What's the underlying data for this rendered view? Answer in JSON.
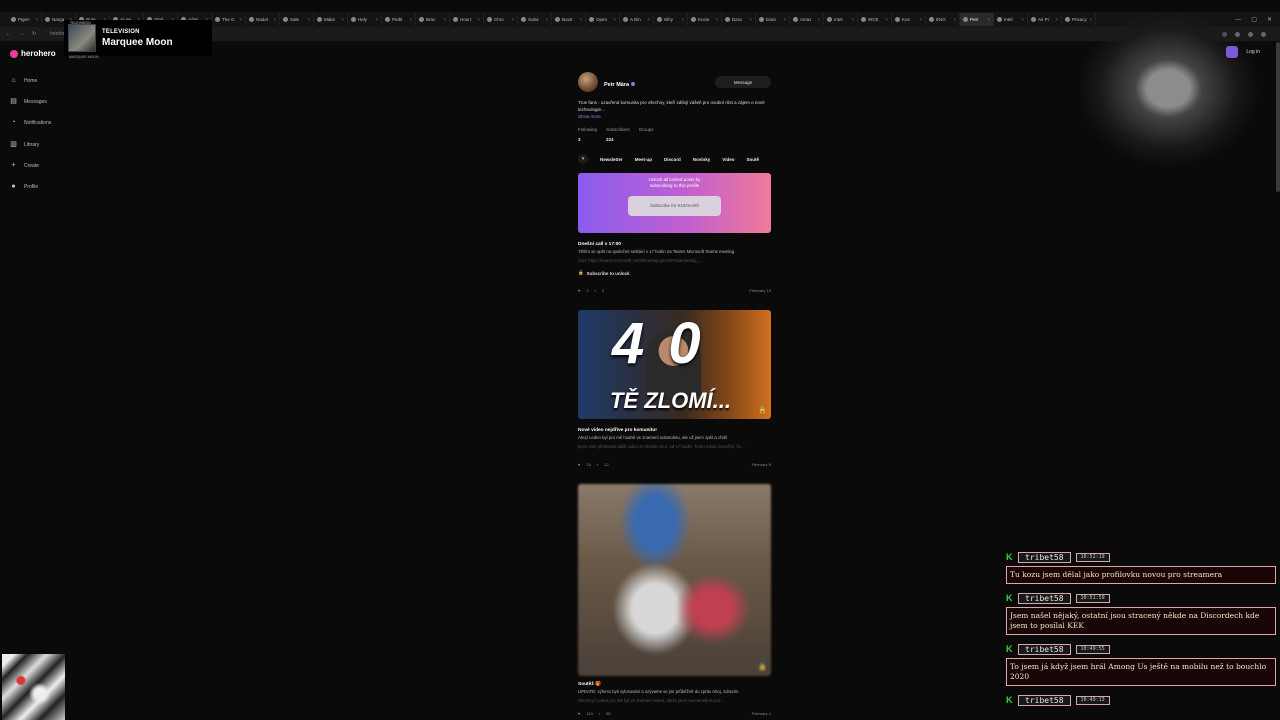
{
  "browser": {
    "tabs": [
      "Pigen",
      "Narga",
      "Rute",
      "AI aw",
      "Shel",
      "Admi",
      "The G",
      "Nadal",
      "Sale",
      "Make",
      "Hely",
      "Pedit",
      "Brav",
      "How t",
      "Chro",
      "Suba",
      "Boxtr",
      "Open",
      "A Din",
      "Why",
      "Know",
      "Dara",
      "brain",
      "Amaz",
      "Intel",
      "WCE",
      "Kos",
      "ENG",
      "Petr",
      "Intel",
      "Air Pi",
      "Privacy"
    ],
    "active_tab": 28,
    "url": "herohero"
  },
  "now_playing": {
    "label": "TELEVISION",
    "title": "Marquee Moon",
    "art_top": "TELEVISION",
    "art_caption": "MARQUEE MOON"
  },
  "site": {
    "logo": "herohero",
    "login": "Log in",
    "nav": [
      {
        "icon": "home-icon",
        "glyph": "⌂",
        "label": "Home"
      },
      {
        "icon": "messages-icon",
        "glyph": "▤",
        "label": "Messages"
      },
      {
        "icon": "notifications-icon",
        "glyph": "◔",
        "label": "Notifications"
      },
      {
        "icon": "library-icon",
        "glyph": "▥",
        "label": "Library"
      },
      {
        "icon": "create-icon",
        "glyph": "+",
        "label": "Create"
      },
      {
        "icon": "profile-icon",
        "glyph": "●",
        "label": "Profile"
      }
    ]
  },
  "profile": {
    "name": "Petr Mára",
    "message_btn": "Message",
    "bio": "True fans - uzavřená komunita pro všechny, kteří sdílejí vášeň pro osobní růst a zájem o nové technologie...",
    "show_more": "Show more",
    "stats": [
      {
        "label": "Following",
        "value": "3"
      },
      {
        "label": "Subscribers",
        "value": "224"
      },
      {
        "label": "Groups",
        "value": ""
      }
    ],
    "tabs": [
      "Newsletter",
      "Meet-up",
      "Discord",
      "Novinky",
      "Video",
      "Soutě"
    ]
  },
  "promo": {
    "text": "Unlock all locked posts by subscribing to this profile",
    "button": "Subscribe for €10/month"
  },
  "posts": [
    {
      "title": "Dnešní call v 17:00",
      "text": "Těším se opět na společné setkání v 17 hodin na Teams Microsoft Teams meeting",
      "text_faded": "Join: https://teams.microsoft.com/l/meetup-join/19%3ameeting_...",
      "unlock": "Subscribe to unlock",
      "likes": "4",
      "comments": "2",
      "date": "February 19"
    },
    {
      "thumb_big": "4 0",
      "thumb_sub": "TĚ ZLOMÍ...",
      "title": "Nové video nejdříve pro komunitu!",
      "text": "Ahoj! Leden byl pro mě hodně ve znamení sobotoletu, ale už jsem zpět a chtěl",
      "text_faded": "bych vám představit další video ze čtvrtek 19.2. od 17 hodin. Tento měsíc hovořím, že...",
      "likes": "24",
      "comments": "12",
      "date": "February 8"
    },
    {
      "title": "Soutěž 🎁",
      "text": "UPDATE: výherci byli vylosováni a ozývame se jim průběžně do zpráv Ahoj, zdravím",
      "text_faded": "všechny! Leden pro mě byl ve znamení videa, takže jsem momentálně pod...",
      "likes": "113",
      "comments": "85",
      "date": "February 4"
    }
  ],
  "chat": [
    {
      "user": "tribet58",
      "time": "10:52:19",
      "text": "Tu kozu jsem dělal jako profilovku novou pro streamera"
    },
    {
      "user": "tribet58",
      "time": "10:51:59",
      "text": "Jsem našel nějaký, ostatní jsou stracený někde na Discordech kde jsem to posílal KEK"
    },
    {
      "user": "tribet58",
      "time": "10:49:55",
      "text": "To jsem já když jsem hrál Among Us ještě na mobilu než to bouchlo 2020"
    },
    {
      "user": "tribet58",
      "time": "10:49:13",
      "text": ""
    }
  ]
}
